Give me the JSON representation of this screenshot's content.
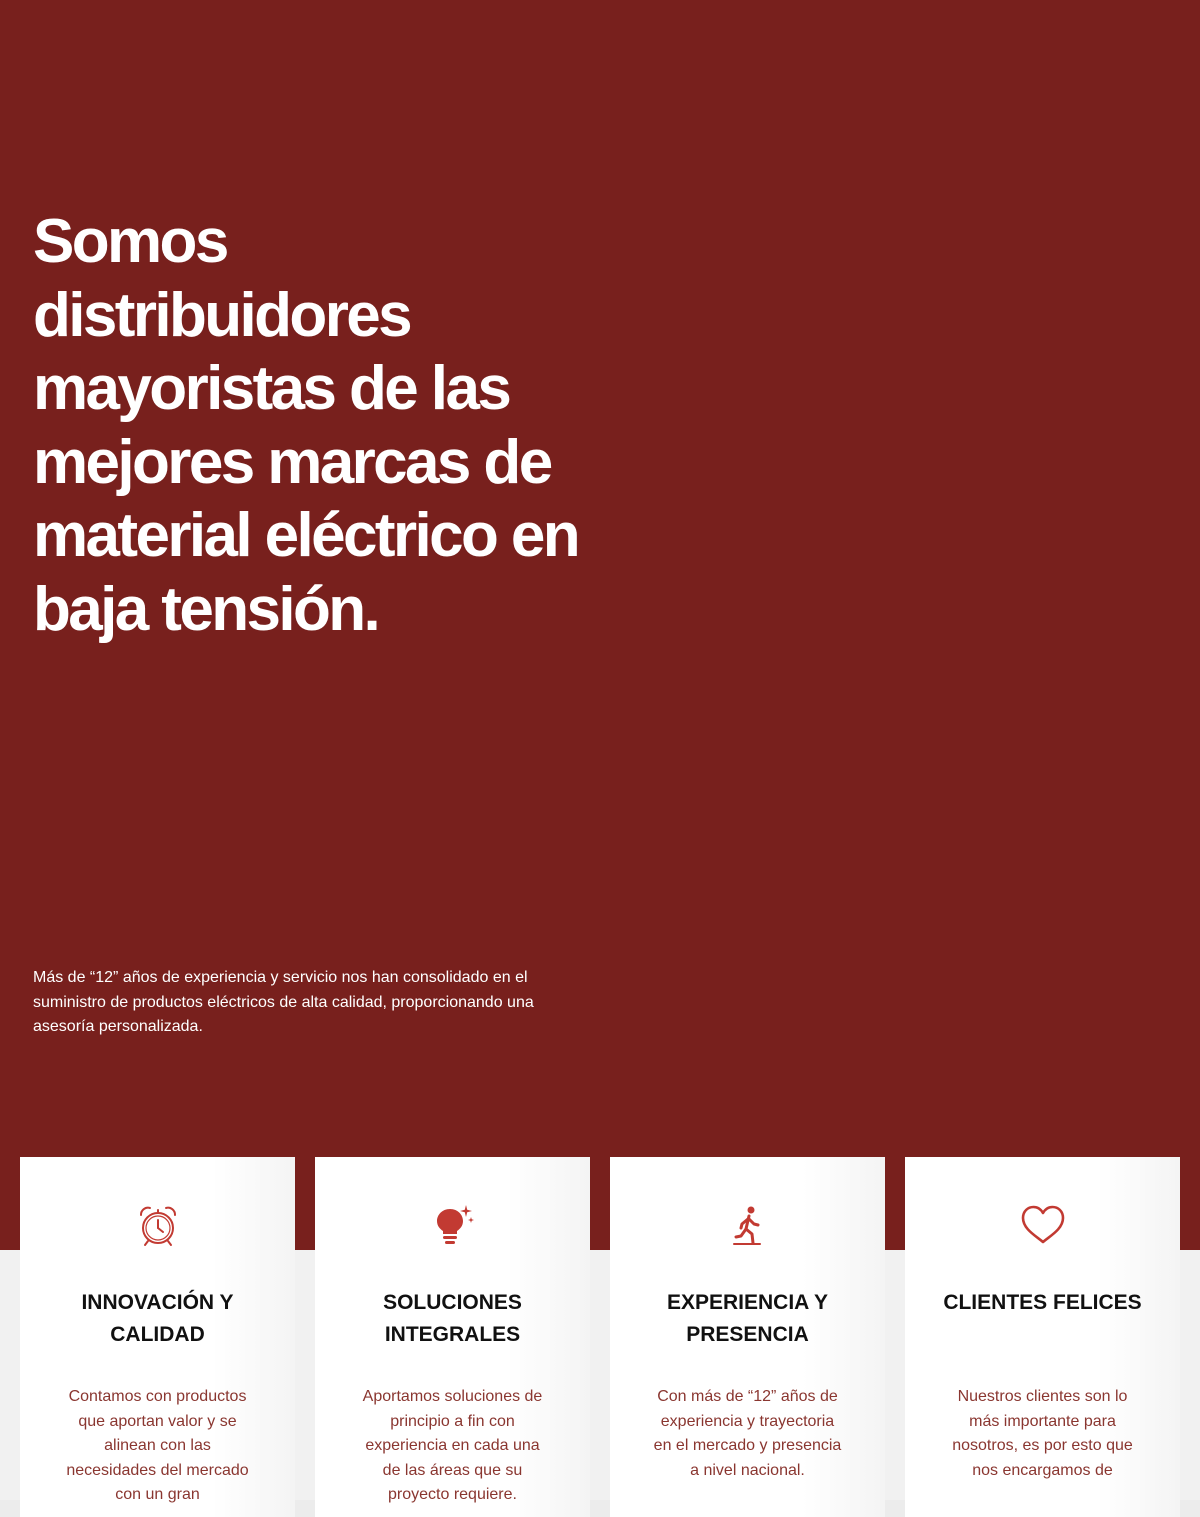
{
  "hero": {
    "title": "Somos distribuidores mayoristas de las mejores marcas de material eléctrico en baja tensión.",
    "text": "Más de “12” años de experiencia y servicio nos han consolidado en el suministro de productos eléctricos de alta calidad, proporcionando una asesoría personalizada."
  },
  "colors": {
    "brand_red": "#78201d",
    "icon_red": "#c23a32",
    "card_text": "#8a3630"
  },
  "features": [
    {
      "icon": "alarm-clock-icon",
      "title": "INNOVACIÓN Y CALIDAD",
      "text": "Contamos con productos que aportan valor y se alinean con las necesidades del mercado con un gran"
    },
    {
      "icon": "lightbulb-icon",
      "title": "SOLUCIONES INTEGRALES",
      "text": "Aportamos soluciones de principio a fin con experiencia en cada una de las áreas que su proyecto requiere."
    },
    {
      "icon": "walking-person-icon",
      "title": "EXPERIENCIA Y PRESENCIA",
      "text": "Con más de “12” años de experiencia y trayectoria en el mercado y presencia a nivel nacional."
    },
    {
      "icon": "heart-icon",
      "title": "CLIENTES FELICES",
      "text": "Nuestros clientes son lo más importante para nosotros, es por esto que nos encargamos de"
    }
  ]
}
